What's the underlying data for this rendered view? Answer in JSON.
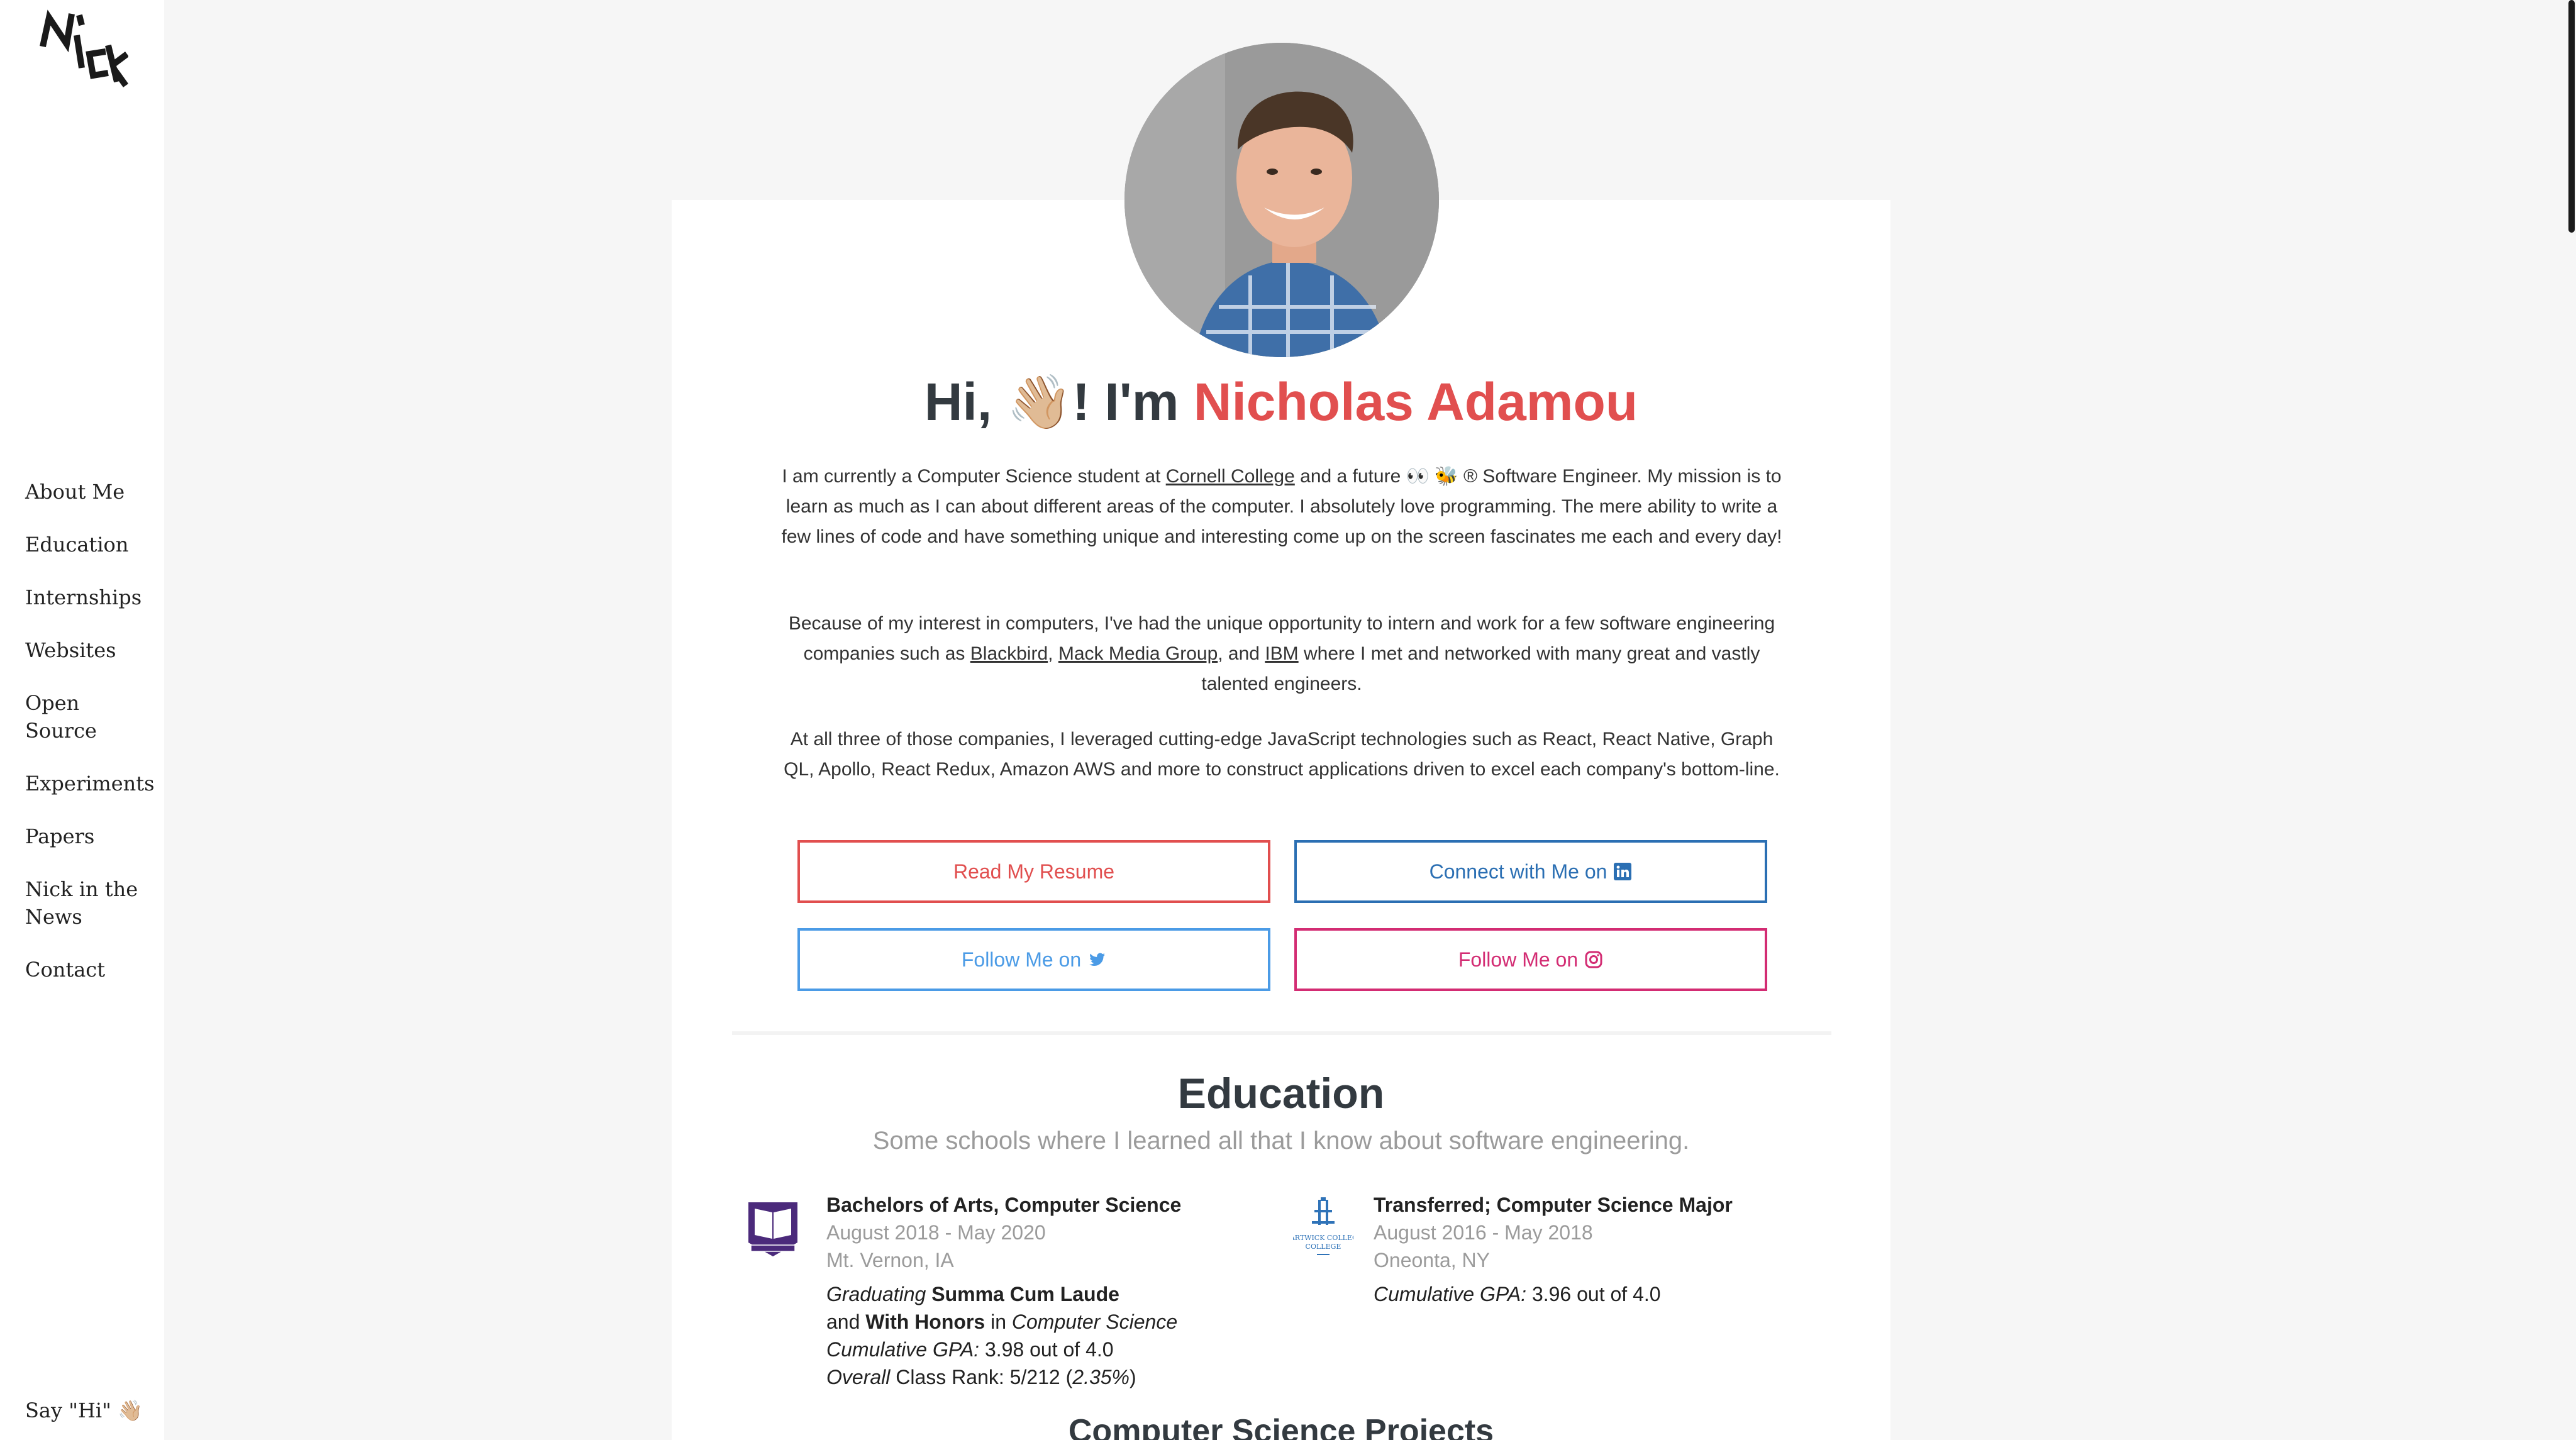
{
  "sidebar": {
    "logo_text": "NICK",
    "items": [
      {
        "label": "About Me"
      },
      {
        "label": "Education"
      },
      {
        "label": "Internships"
      },
      {
        "label": "Websites"
      },
      {
        "label": "Open Source"
      },
      {
        "label": "Experiments"
      },
      {
        "label": "Papers"
      },
      {
        "label": "Nick in the News"
      },
      {
        "label": "Contact"
      }
    ],
    "say_hi": "Say \"Hi\" 👋🏼"
  },
  "hero": {
    "greeting": "Hi, 👋🏼! I'm ",
    "name": "Nicholas Adamou",
    "avatar_icon": "profile-photo"
  },
  "about": {
    "p1_a": "I am currently a Computer Science student at ",
    "p1_link": "Cornell College",
    "p1_b": " and a future 👀 🐝 ® Software Engineer. My mission is to learn as much as I can about different areas of the computer. I absolutely love programming. The mere ability to write a few lines of code and have something unique and interesting come up on the screen fascinates me each and every day!",
    "p2_a": "Because of my interest in computers, I've had the unique opportunity to intern and work for a few software engineering companies such as ",
    "p2_link1": "Blackbird",
    "p2_sep1": ", ",
    "p2_link2": "Mack Media Group",
    "p2_sep2": ", and ",
    "p2_link3": "IBM",
    "p2_b": " where I met and networked with many great and vastly talented engineers.",
    "p3": "At all three of those companies, I leveraged cutting-edge JavaScript technologies such as React, React Native, Graph QL, Apollo, React Redux, Amazon AWS and more to construct applications driven to excel each company's bottom-line."
  },
  "buttons": {
    "resume": "Read My Resume",
    "linkedin": "Connect with Me on",
    "twitter": "Follow Me on",
    "instagram": "Follow Me on"
  },
  "colors": {
    "accent": "#e14f4f",
    "linkedin": "#2b6fb3",
    "twitter": "#4b9be6",
    "instagram": "#d32c73"
  },
  "education": {
    "title": "Education",
    "subtitle": "Some schools where I learned all that I know about software engineering.",
    "schools": [
      {
        "degree": "Bachelors of Arts, Computer Science",
        "dates": "August 2018 - May 2020",
        "location": "Mt. Vernon, IA",
        "line1_em": "Graduating",
        "line1_strong": "Summa Cum Laude",
        "line2_a": "and",
        "line2_strong": "With Honors",
        "line2_b": "in",
        "line2_em": "Computer Science",
        "gpa_label": "Cumulative GPA:",
        "gpa_value": "3.98 out of 4.0",
        "rank_em": "Overall",
        "rank_text": "Class Rank: 5/212 (",
        "rank_pct": "2.35%",
        "rank_close": ")"
      },
      {
        "degree": "Transferred; Computer Science Major",
        "dates": "August 2016 - May 2018",
        "location": "Oneonta, NY",
        "gpa_label": "Cumulative GPA:",
        "gpa_value": "3.96 out of 4.0",
        "logo_text": "HARTWICK COLLEGE"
      }
    ]
  },
  "next_section": {
    "title": "Computer Science Projects"
  }
}
